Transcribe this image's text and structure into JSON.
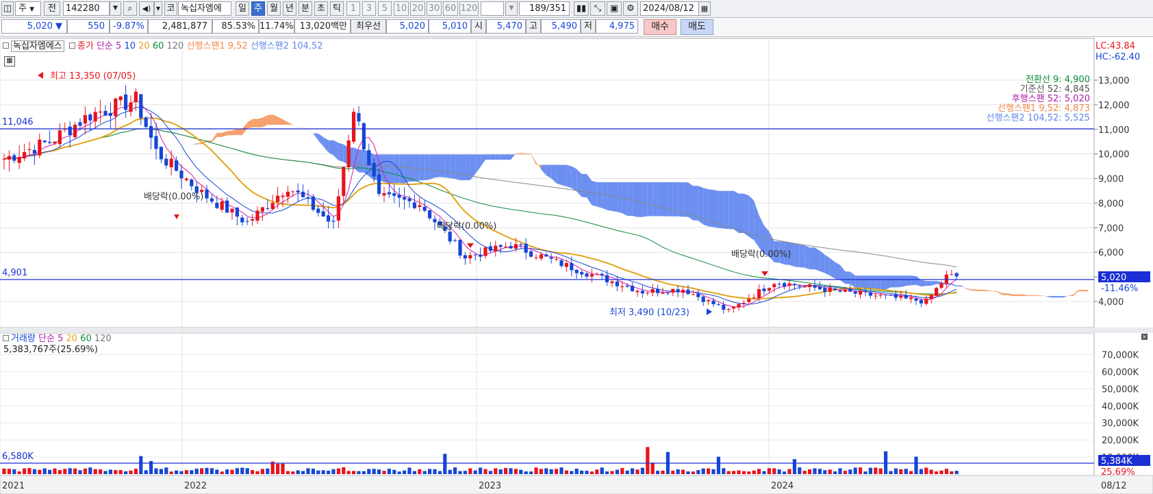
{
  "toolbar": {
    "period_main": "주",
    "prev_label": "전",
    "code": "142280",
    "stock_code_prefix": "코",
    "stock_name": "녹십자엠에",
    "periods": [
      "일",
      "주",
      "월",
      "년",
      "분",
      "초",
      "틱"
    ],
    "selected_period": "주",
    "intervals": [
      "1",
      "3",
      "5",
      "10",
      "20",
      "30",
      "60",
      "120"
    ],
    "count": "189",
    "total": "/351",
    "date": "2024/08/12"
  },
  "quote": {
    "price": "5,020",
    "change_arrow": "▼",
    "change": "550",
    "change_pct": "-9.87%",
    "volume": "2,481,877",
    "vol_ratio": "85.53%",
    "turnover": "11.74%",
    "trade_value": "13,020백만",
    "best_label": "최우선",
    "ask": "5,020",
    "bid": "5,010",
    "open_label": "시",
    "open": "5,470",
    "high_label": "고",
    "high": "5,490",
    "low_label": "저",
    "low": "4,975",
    "buy_label": "매수",
    "sell_label": "매도"
  },
  "price_legend": {
    "stock": "녹십자엠에스",
    "close": "종가",
    "ma_type": "단순",
    "ma5": "5",
    "ma10": "10",
    "ma20": "20",
    "ma60": "60",
    "ma120": "120",
    "span1": "선행스팬1 9,52",
    "span2": "선행스팬2 104,52"
  },
  "ichimoku_values": {
    "conversion": "전환선 9: 4,900",
    "base": "기준선 52: 4,845",
    "lagging": "후행스팬 52: 5,020",
    "span1": "선행스팬1 9,52: 4,873",
    "span2": "선행스팬2 104,52: 5,525"
  },
  "lc_hc": {
    "lc": "LC:43.84",
    "hc": "HC:-62.40"
  },
  "price_axis": [
    "13,000",
    "12,000",
    "11,000",
    "10,000",
    "9,000",
    "8,000",
    "7,000",
    "6,000",
    "5,000",
    "4,000"
  ],
  "hlines": {
    "upper": "11,046",
    "lower": "4,901"
  },
  "current_price_box": {
    "price": "5,020",
    "pct": "-11.46%"
  },
  "annotations": {
    "high": "최고 13,350 (07/05)",
    "low": "최저 3,490 (10/23)",
    "dividends": [
      "배당락(0.00%)",
      "배당락(0.00%)",
      "배당락(0.00%)"
    ]
  },
  "volume_legend": {
    "title": "거래량",
    "ma_type": "단순",
    "ma5": "5",
    "ma20": "20",
    "ma60": "60",
    "ma120": "120",
    "current": "5,383,767주(25.69%)"
  },
  "volume_axis": [
    "70,000K",
    "60,000K",
    "50,000K",
    "40,000K",
    "30,000K",
    "20,000K",
    "10,000K"
  ],
  "volume_hline": "6,580K",
  "volume_box": {
    "value": "5,384K",
    "pct": "25.69%"
  },
  "date_axis": [
    "2021",
    "2022",
    "2023",
    "2024"
  ],
  "end_date": "08/12",
  "colors": {
    "up": "#e8141c",
    "down": "#1646d6",
    "cloud_up": "#f5a06e",
    "cloud_down": "#6c8ff0"
  },
  "chart_data": {
    "type": "candlestick",
    "timeframe": "weekly",
    "y_axis_range": [
      3300,
      13800
    ],
    "key_levels": {
      "high": 13350,
      "low": 3490,
      "current": 5020,
      "line_upper": 11046,
      "line_lower": 4901
    },
    "approx_close_path": [
      {
        "date": "2021-01",
        "close": 9800
      },
      {
        "date": "2021-03",
        "close": 10500
      },
      {
        "date": "2021-05",
        "close": 11600
      },
      {
        "date": "2021-07",
        "close": 12200
      },
      {
        "date": "2021-08",
        "close": 10100
      },
      {
        "date": "2021-10",
        "close": 8400
      },
      {
        "date": "2021-12",
        "close": 7200
      },
      {
        "date": "2022-02",
        "close": 8700
      },
      {
        "date": "2022-04",
        "close": 7100
      },
      {
        "date": "2022-05",
        "close": 11900
      },
      {
        "date": "2022-06",
        "close": 8200
      },
      {
        "date": "2022-08",
        "close": 8000
      },
      {
        "date": "2022-10",
        "close": 5800
      },
      {
        "date": "2022-12",
        "close": 6300
      },
      {
        "date": "2023-03",
        "close": 5300
      },
      {
        "date": "2023-06",
        "close": 4400
      },
      {
        "date": "2023-08",
        "close": 4500
      },
      {
        "date": "2023-10",
        "close": 3600
      },
      {
        "date": "2023-12",
        "close": 4800
      },
      {
        "date": "2024-03",
        "close": 4400
      },
      {
        "date": "2024-07",
        "close": 4000
      },
      {
        "date": "2024-08",
        "close": 5020
      }
    ]
  }
}
